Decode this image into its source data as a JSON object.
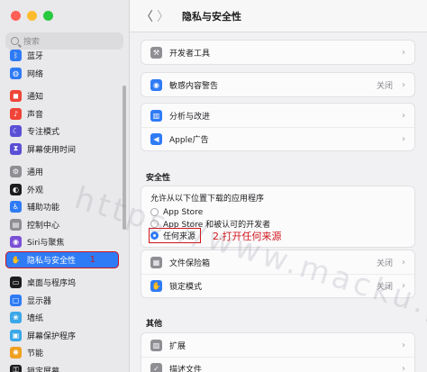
{
  "window": {
    "title": "隐私与安全性",
    "back_glyph": "〈",
    "forward_glyph": "〉"
  },
  "sidebar": {
    "search_placeholder": "搜索",
    "items": [
      {
        "label": "蓝牙",
        "icon": "bluetooth-icon",
        "color": "#2f7bf5",
        "glyph": "ᛒ"
      },
      {
        "label": "网络",
        "icon": "network-icon",
        "color": "#2f7bf5",
        "glyph": "◍"
      },
      {
        "label": "通知",
        "icon": "bell-icon",
        "color": "#f04438",
        "glyph": "◼"
      },
      {
        "label": "声音",
        "icon": "speaker-icon",
        "color": "#f04438",
        "glyph": "♪"
      },
      {
        "label": "专注模式",
        "icon": "moon-icon",
        "color": "#5b4fd6",
        "glyph": "☾"
      },
      {
        "label": "屏幕使用时间",
        "icon": "hourglass-icon",
        "color": "#5b4fd6",
        "glyph": "⧗"
      },
      {
        "label": "通用",
        "icon": "gear-icon",
        "color": "#8e8e93",
        "glyph": "⚙"
      },
      {
        "label": "外观",
        "icon": "appearance-icon",
        "color": "#1c1c1e",
        "glyph": "◐"
      },
      {
        "label": "辅助功能",
        "icon": "accessibility-icon",
        "color": "#2f7bf5",
        "glyph": "♿"
      },
      {
        "label": "控制中心",
        "icon": "control-center-icon",
        "color": "#8e8e93",
        "glyph": "▤"
      },
      {
        "label": "Siri与聚焦",
        "icon": "siri-icon",
        "color": "#7a4fd6",
        "glyph": "◉"
      },
      {
        "label": "隐私与安全性",
        "icon": "hand-icon",
        "color": "#2f7bf5",
        "glyph": "✋"
      },
      {
        "label": "桌面与程序坞",
        "icon": "dock-icon",
        "color": "#1c1c1e",
        "glyph": "▭"
      },
      {
        "label": "显示器",
        "icon": "display-icon",
        "color": "#2f7bf5",
        "glyph": "▢"
      },
      {
        "label": "墙纸",
        "icon": "wallpaper-icon",
        "color": "#3aa7e8",
        "glyph": "❀"
      },
      {
        "label": "屏幕保护程序",
        "icon": "screensaver-icon",
        "color": "#3aa7e8",
        "glyph": "▣"
      },
      {
        "label": "节能",
        "icon": "bulb-icon",
        "color": "#f0a020",
        "glyph": "✺"
      },
      {
        "label": "锁定屏幕",
        "icon": "lock-icon",
        "color": "#1c1c1e",
        "glyph": "⚿"
      }
    ],
    "annotation": "1"
  },
  "main": {
    "rows_top": [
      {
        "label": "开发者工具",
        "icon": "hammer-icon",
        "color": "#8e8e93",
        "glyph": "⚒",
        "value": ""
      },
      {
        "label": "敏感内容警告",
        "icon": "eye-icon",
        "color": "#2f7bf5",
        "glyph": "◉",
        "value": "关闭"
      },
      {
        "label": "分析与改进",
        "icon": "chart-icon",
        "color": "#2f7bf5",
        "glyph": "▥",
        "value": ""
      },
      {
        "label": "Apple广告",
        "icon": "megaphone-icon",
        "color": "#2f7bf5",
        "glyph": "◀",
        "value": ""
      }
    ],
    "security": {
      "heading": "安全性",
      "prompt": "允许从以下位置下载的应用程序",
      "options": [
        "App Store",
        "App Store 和被认可的开发者",
        "任何来源"
      ],
      "selected_index": 2,
      "annotation": "2.打开任何来源"
    },
    "rows_security": [
      {
        "label": "文件保险箱",
        "icon": "vault-icon",
        "color": "#8e8e93",
        "glyph": "▦",
        "value": "关闭"
      },
      {
        "label": "锁定模式",
        "icon": "hand-icon",
        "color": "#2f7bf5",
        "glyph": "✋",
        "value": "关闭"
      }
    ],
    "other": {
      "heading": "其他",
      "rows": [
        {
          "label": "扩展",
          "icon": "puzzle-icon",
          "color": "#8e8e93",
          "glyph": "▨",
          "value": ""
        },
        {
          "label": "描述文件",
          "icon": "profile-icon",
          "color": "#8e8e93",
          "glyph": "✓",
          "value": ""
        }
      ]
    }
  },
  "watermark": "https://www.macku.pro/",
  "colors": {
    "accent": "#2f7bf5",
    "annotation_red": "#d0141a"
  }
}
